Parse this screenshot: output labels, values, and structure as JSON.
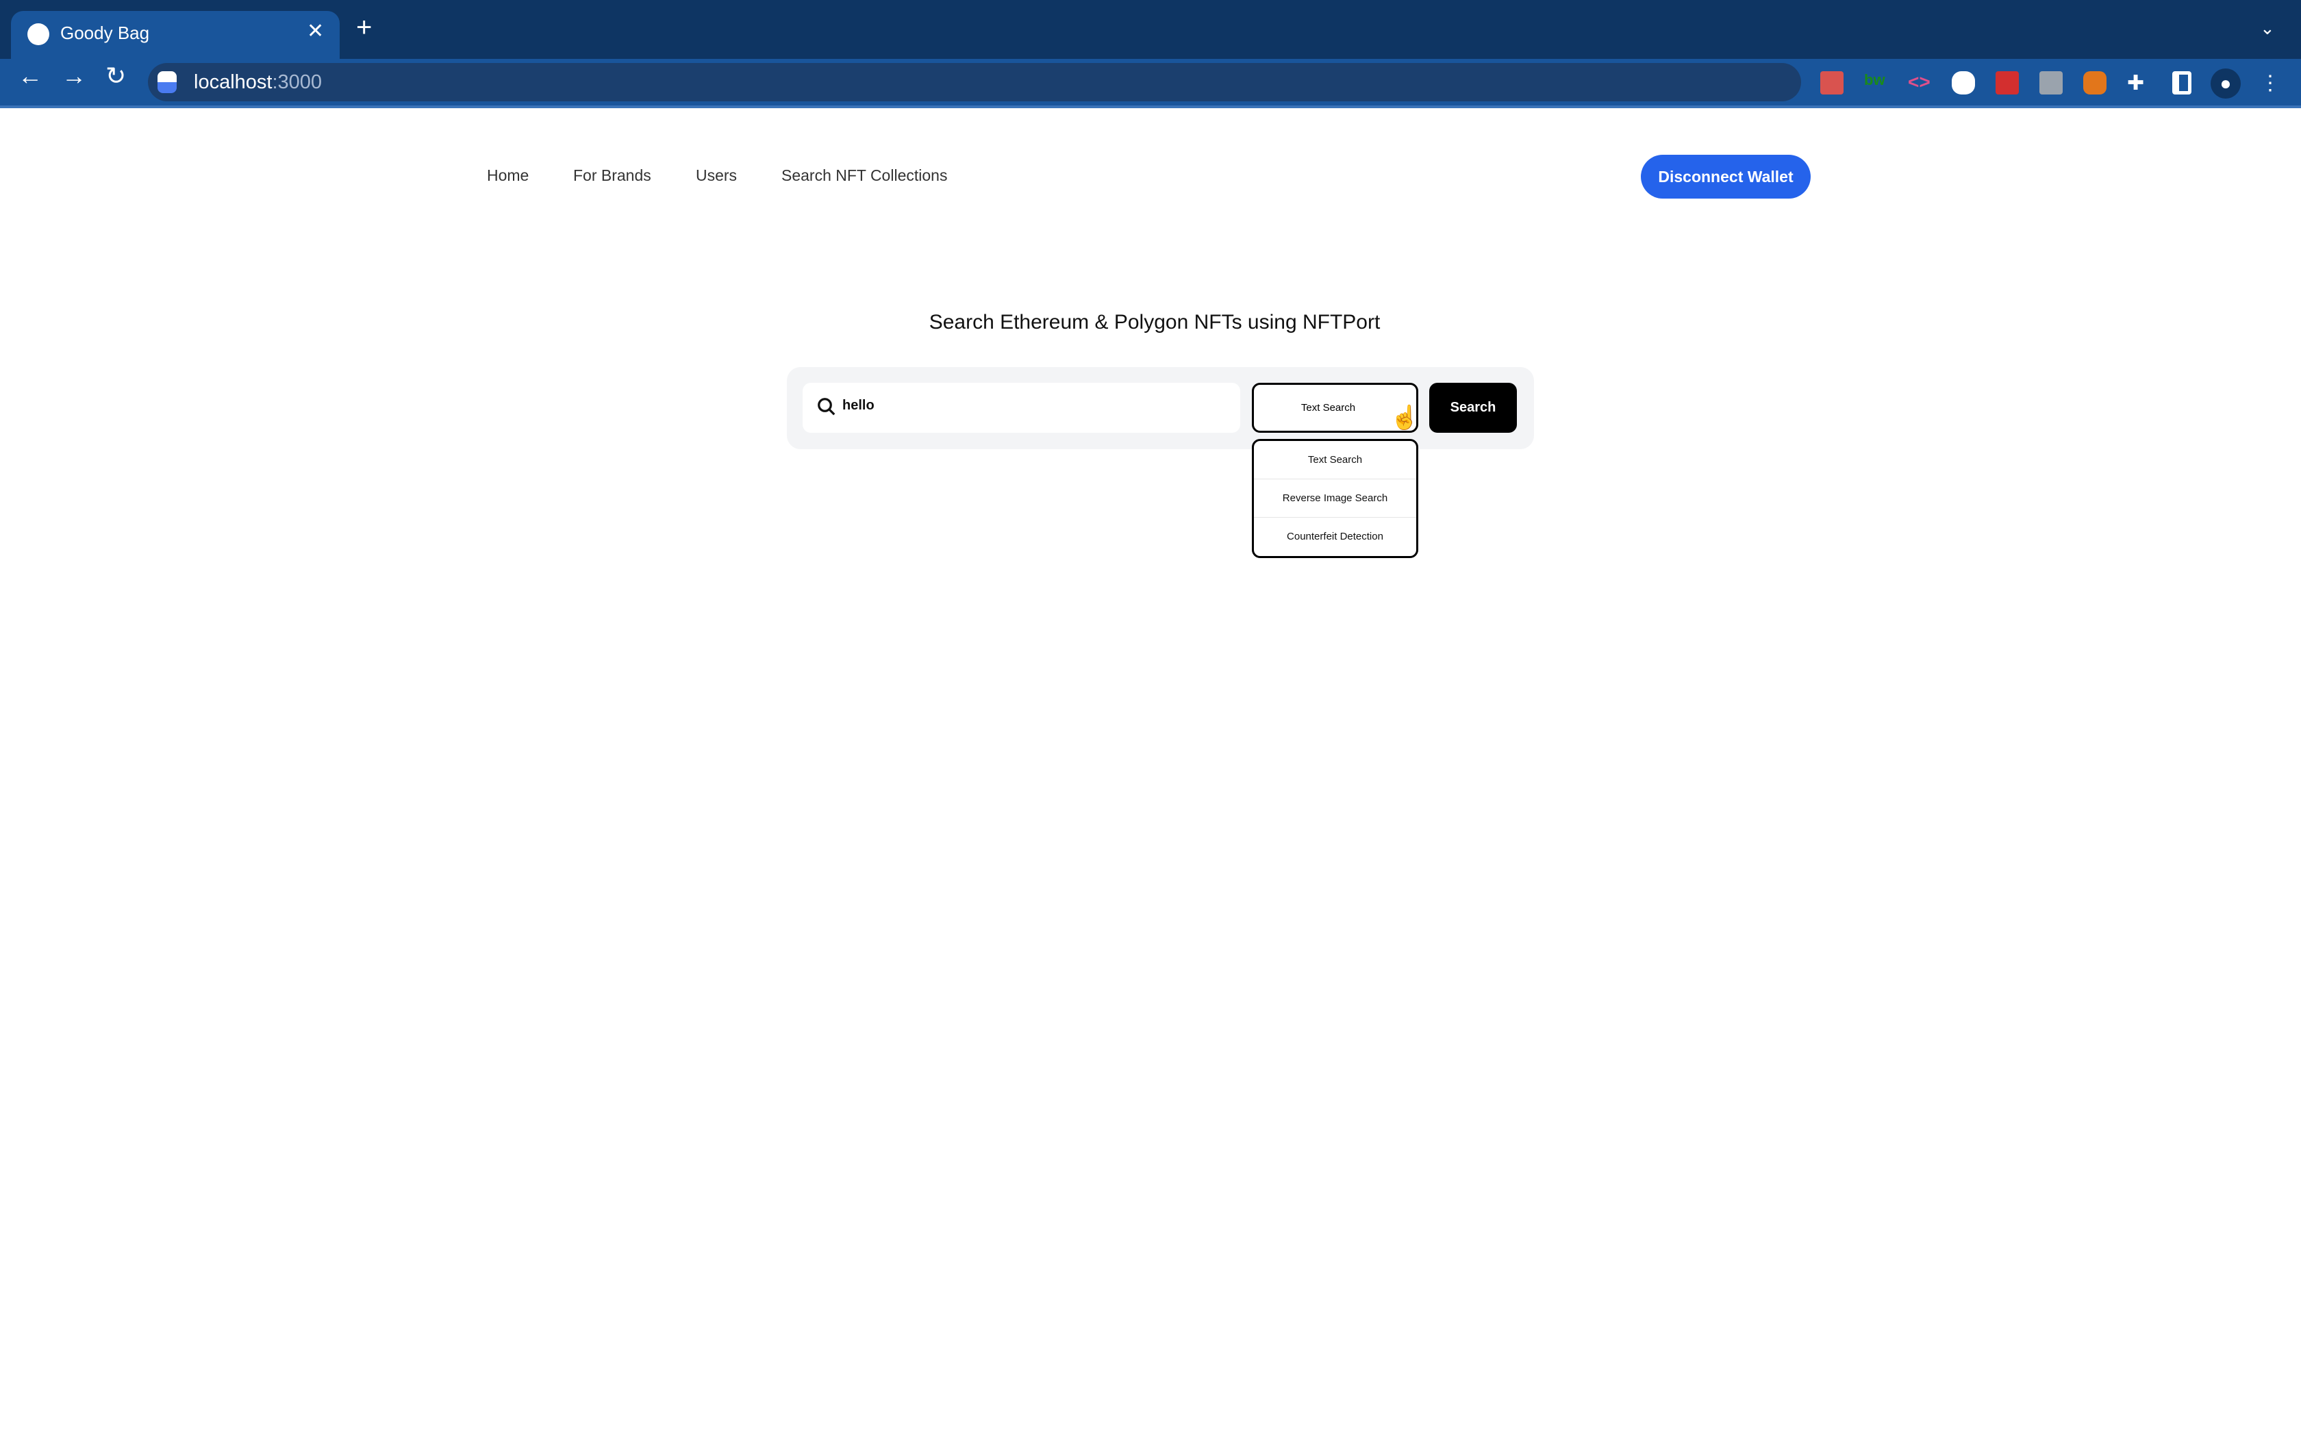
{
  "browser": {
    "tab_title": "Goody Bag",
    "url_host": "localhost",
    "url_port": ":3000",
    "extensions": [
      "react-devtools-icon",
      "bw-icon",
      "code-icon",
      "chat-icon",
      "lastpass-icon",
      "docs-icon",
      "metamask-icon",
      "puzzle-icon",
      "sidepanel-icon",
      "profile-icon",
      "menu-icon"
    ]
  },
  "nav": {
    "items": [
      "Home",
      "For Brands",
      "Users",
      "Search NFT Collections"
    ],
    "disconnect": "Disconnect Wallet"
  },
  "main": {
    "heading": "Search Ethereum & Polygon NFTs using NFTPort",
    "search_value": "hello",
    "mode_selected": "Text Search",
    "search_button": "Search",
    "mode_options": [
      "Text Search",
      "Reverse Image Search",
      "Counterfeit Detection"
    ]
  },
  "colors": {
    "accent": "#2563eb",
    "tabbar": "#0e3563",
    "toolbar": "#19559b"
  }
}
